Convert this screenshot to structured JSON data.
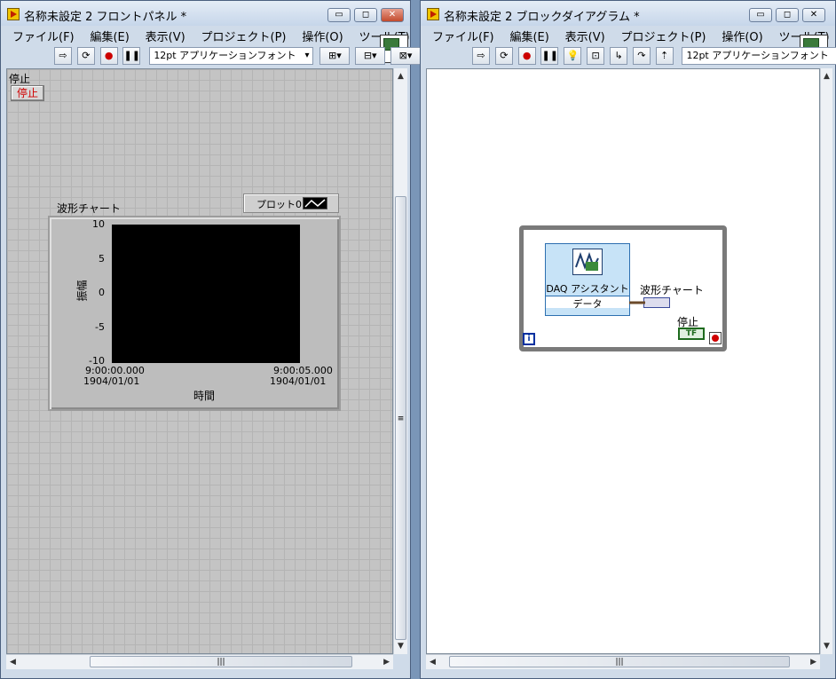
{
  "front_panel": {
    "title": "名称未設定 2 フロントパネル *",
    "menu": [
      "ファイル(F)",
      "編集(E)",
      "表示(V)",
      "プロジェクト(P)",
      "操作(O)",
      "ツール(T)"
    ],
    "font_label": "12pt アプリケーションフォント",
    "vi_number": "2",
    "stop_label": "停止",
    "stop_button": "停止",
    "chart": {
      "label": "波形チャート",
      "ylabel": "振幅",
      "xlabel": "時間",
      "y_ticks": [
        "10",
        "5",
        "0",
        "-5",
        "-10"
      ],
      "x_start_time": "9:00:00.000",
      "x_start_date": "1904/01/01",
      "x_end_time": "9:00:05.000",
      "x_end_date": "1904/01/01",
      "legend": "プロット0"
    }
  },
  "block_diagram": {
    "title": "名称未設定 2 ブロックダイアグラム *",
    "menu": [
      "ファイル(F)",
      "編集(E)",
      "表示(V)",
      "プロジェクト(P)",
      "操作(O)",
      "ツール(T)"
    ],
    "font_label": "12pt アプリケーションフォント",
    "vi_number": "2",
    "daq_name": "DAQ アシスタント",
    "daq_output": "データ",
    "chart_terminal": "波形チャート",
    "stop_terminal": "停止",
    "iteration": "i",
    "bool_text": "TF"
  },
  "chart_data": {
    "type": "line",
    "series": [
      {
        "name": "プロット0",
        "values": []
      }
    ],
    "ylabel": "振幅",
    "xlabel": "時間",
    "ylim": [
      -10,
      10
    ],
    "y_ticks": [
      10,
      5,
      0,
      -5,
      -10
    ],
    "grid": false
  }
}
